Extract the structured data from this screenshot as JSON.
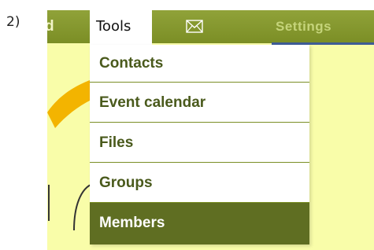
{
  "step_label": "2)",
  "menubar": {
    "cut_item": "d",
    "tools_label": "Tools",
    "mail_icon": "envelope-icon",
    "settings_label": "Settings"
  },
  "dropdown": {
    "items": [
      {
        "label": "Contacts",
        "state": "normal"
      },
      {
        "label": "Event calendar",
        "state": "normal"
      },
      {
        "label": "Files",
        "state": "normal"
      },
      {
        "label": "Groups",
        "state": "normal"
      },
      {
        "label": "Members",
        "state": "hover"
      }
    ]
  },
  "colors": {
    "menubar": "#7b8e25",
    "background": "#f9fda9",
    "active_item": "#5f6e22",
    "item_text": "#4a5a1c",
    "accent": "#3e5c95"
  }
}
